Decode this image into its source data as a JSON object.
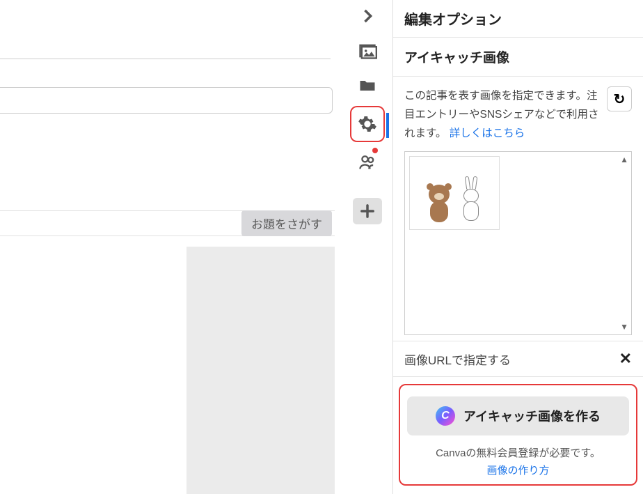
{
  "main": {
    "topic_button": "お題をさがす"
  },
  "rail": {
    "icons": [
      "chevron-right",
      "image",
      "folder",
      "gear",
      "people",
      "plus"
    ]
  },
  "panel": {
    "title": "編集オプション",
    "eyecatch": {
      "heading": "アイキャッチ画像",
      "description": "この記事を表す画像を指定できます。注目エントリーやSNSシェアなどで利用されます。",
      "more_link": "詳しくはこちら",
      "url_label": "画像URLで指定する"
    },
    "canva": {
      "button_label": "アイキャッチ画像を作る",
      "badge": "C",
      "note": "Canvaの無料会員登録が必要です。",
      "howto_link": "画像の作り方"
    }
  }
}
